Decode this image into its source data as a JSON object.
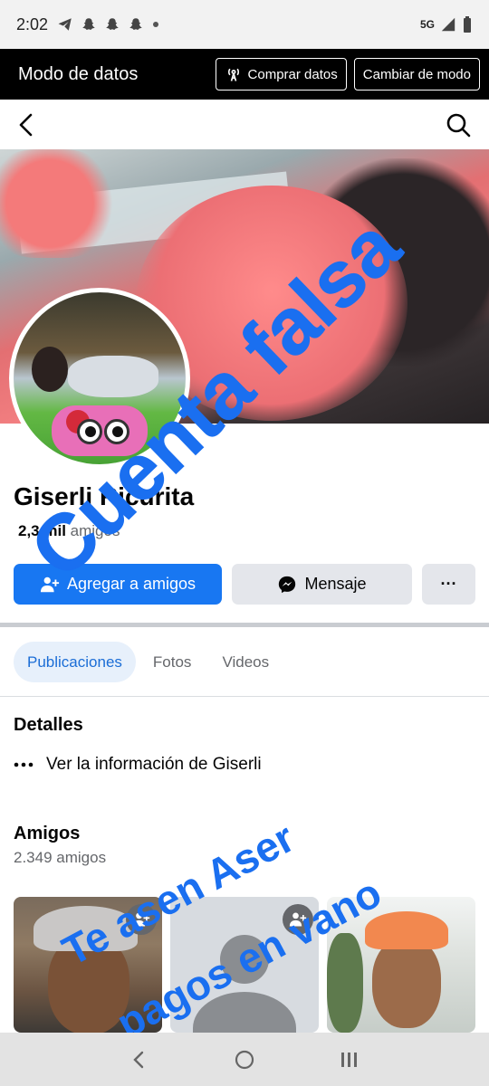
{
  "status_bar": {
    "time": "2:02",
    "network": "5G",
    "icons": [
      "telegram-icon",
      "snapchat-icon",
      "snapchat-icon",
      "snapchat-icon",
      "dot-icon"
    ]
  },
  "data_mode_bar": {
    "title": "Modo de datos",
    "buy_label": "Comprar datos",
    "switch_label": "Cambiar de modo"
  },
  "profile": {
    "name": "Giserli Ricurita",
    "friends_count": "2,3 mil",
    "friends_word": "amigos"
  },
  "actions": {
    "add_friend": "Agregar a amigos",
    "message": "Mensaje",
    "more": "···"
  },
  "tabs": [
    {
      "label": "Publicaciones",
      "active": true
    },
    {
      "label": "Fotos",
      "active": false
    },
    {
      "label": "Videos",
      "active": false
    }
  ],
  "details": {
    "title": "Detalles",
    "info_link": "Ver la información de Giserli"
  },
  "friends": {
    "title": "Amigos",
    "count_text": "2.349 amigos"
  },
  "overlay_text": {
    "line1": "Cuenta falsa",
    "line2": "Te asen Aser",
    "line3": "pagos en vano"
  },
  "colors": {
    "accent": "#1877f2",
    "overlay": "#1a6ff0",
    "tab_active_bg": "#e7f0fb"
  }
}
